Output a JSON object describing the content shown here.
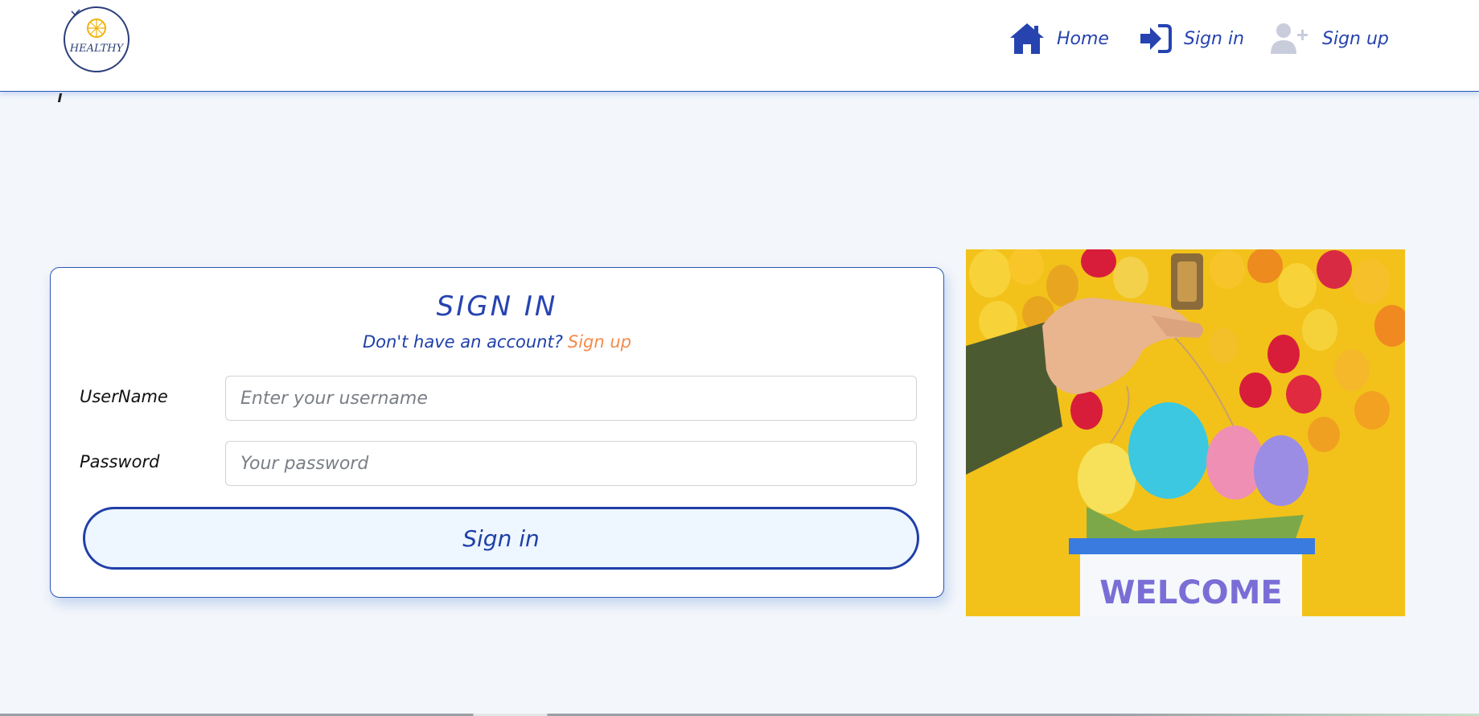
{
  "brand": {
    "logo_text": "HEALTHY"
  },
  "nav": {
    "home_label": "Home",
    "signin_label": "Sign in",
    "signup_label": "Sign up"
  },
  "form": {
    "title": "SIGN IN",
    "subtitle": "Don't have an account?",
    "subtitle_link": "Sign up",
    "username_label": "UserName",
    "username_placeholder": "Enter your username",
    "password_label": "Password",
    "password_placeholder": "Your password",
    "submit_label": "Sign in"
  },
  "hero": {
    "sign_text": "WELCOME"
  },
  "colors": {
    "accent": "#2643b0",
    "link": "#f58b4c",
    "background": "#f3f6fa",
    "hero_bg": "#f2c21a"
  },
  "icons": {
    "home": "home-icon",
    "signin": "sign-in-icon",
    "signup": "user-plus-icon"
  }
}
